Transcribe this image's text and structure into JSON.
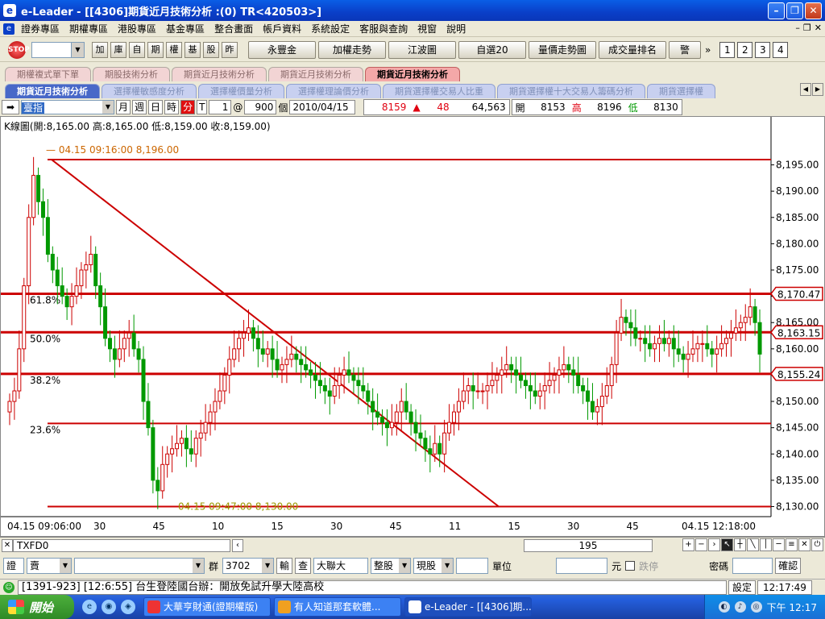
{
  "window": {
    "title": "e-Leader - [[4306]期貨近月技術分析 :(0) TR<420503>]"
  },
  "menu": [
    "證券專區",
    "期權專區",
    "港股專區",
    "基金專區",
    "整合畫面",
    "帳戶資料",
    "系統設定",
    "客服與查詢",
    "視窗",
    "說明"
  ],
  "toolbar": {
    "square_buttons": [
      "加",
      "庫",
      "自",
      "期",
      "權",
      "基",
      "股",
      "昨"
    ],
    "buttons": [
      "永豐金",
      "加權走勢",
      "江波圖",
      "自選20",
      "量價走勢圖",
      "成交量排名",
      "警"
    ],
    "numbers": [
      "1",
      "2",
      "3",
      "4"
    ]
  },
  "tabs1": [
    "期權複式單下單",
    "期股技術分析",
    "期貨近月技術分析",
    "期貨近月技術分析",
    "期貨近月技術分析"
  ],
  "tabs1_active": 4,
  "tabs2": [
    "期貨近月技術分析",
    "選擇權敏感度分析",
    "選擇權價量分析",
    "選擇權理論價分析",
    "期貨選擇權交易人比重",
    "期貨選擇權十大交易人籌碼分析",
    "期貨選擇權"
  ],
  "tabs2_active": 0,
  "quote": {
    "symbol": "臺指",
    "periods": [
      "月",
      "週",
      "日",
      "時",
      "分",
      "T"
    ],
    "active_period": "分",
    "interval": "1",
    "at": "@",
    "count": "900",
    "count_unit": "個",
    "date": "2010/04/15",
    "price": "8159",
    "change_arrow": "▲",
    "change": "48",
    "volume": "64,563",
    "open_label": "開",
    "open": "8153",
    "high_label": "高",
    "high": "8196",
    "low_label": "低",
    "low": "8130"
  },
  "chart_info": "K線圖(開:8,165.00 高:8,165.00 低:8,159.00 收:8,159.00)",
  "chart_data": {
    "type": "candlestick",
    "y_ticks": [
      "8,195.00",
      "8,190.00",
      "8,185.00",
      "8,180.00",
      "8,175.00",
      "8,170.00",
      "8,165.00",
      "8,160.00",
      "8,155.00",
      "8,150.00",
      "8,145.00",
      "8,140.00",
      "8,135.00",
      "8,130.00"
    ],
    "ylim": [
      8129,
      8198
    ],
    "x_ticks": [
      "04.15 09:06:00",
      "30",
      "45",
      "10",
      "15",
      "30",
      "45",
      "11",
      "15",
      "30",
      "45",
      "04.15 12:18:00"
    ],
    "high_annotation": "04.15 09:16:00  8,196.00",
    "low_annotation": "04.15 09:47:00  8,130.00",
    "fib_levels": [
      {
        "label": "61.8%",
        "value": 8170.47,
        "tag": "8,170.47"
      },
      {
        "label": "50.0%",
        "value": 8163.15,
        "tag": "8,163.15"
      },
      {
        "label": "38.2%",
        "value": 8155.24,
        "tag": "8,155.24"
      },
      {
        "label": "23.6%",
        "value": 8145.8,
        "tag": ""
      }
    ],
    "top_line": 8196,
    "bottom_line": 8130,
    "trend_line": {
      "from_x": 0.06,
      "from_y": 8196,
      "to_x": 0.645,
      "to_y": 8130
    },
    "close_series": [
      8150,
      8152,
      8160,
      8172,
      8185,
      8193,
      8188,
      8185,
      8178,
      8175,
      8172,
      8170,
      8168,
      8170,
      8172,
      8175,
      8176,
      8178,
      8172,
      8168,
      8162,
      8160,
      8158,
      8160,
      8162,
      8163,
      8160,
      8158,
      8150,
      8145,
      8135,
      8133,
      8138,
      8140,
      8141,
      8142,
      8143,
      8141,
      8140,
      8143,
      8144,
      8146,
      8148,
      8150,
      8152,
      8155,
      8158,
      8160,
      8162,
      8163,
      8164,
      8162,
      8160,
      8159,
      8160,
      8158,
      8156,
      8157,
      8158,
      8159,
      8158,
      8157,
      8156,
      8155,
      8154,
      8153,
      8152,
      8151,
      8153,
      8155,
      8156,
      8155,
      8154,
      8153,
      8152,
      8150,
      8148,
      8147,
      8146,
      8145,
      8146,
      8148,
      8150,
      8148,
      8146,
      8144,
      8143,
      8141,
      8140,
      8142,
      8140,
      8144,
      8146,
      8148,
      8150,
      8152,
      8153,
      8152,
      8152,
      8152,
      8153,
      8154,
      8155,
      8156,
      8157,
      8156,
      8155,
      8154,
      8153,
      8152,
      8151,
      8152,
      8153,
      8154,
      8155,
      8156,
      8157,
      8156,
      8155,
      8153,
      8152,
      8150,
      8148,
      8149,
      8151,
      8153,
      8157,
      8163,
      8166,
      8165,
      8164,
      8162,
      8162,
      8161,
      8160,
      8161,
      8162,
      8161,
      8162,
      8160,
      8159,
      8158,
      8159,
      8160,
      8161,
      8161,
      8160,
      8159,
      8160,
      8161,
      8162,
      8163,
      8164,
      8165,
      8166,
      8168,
      8165,
      8159
    ]
  },
  "scroll": {
    "symbol": "TXFD0",
    "position": "195"
  },
  "order": {
    "market": "證",
    "side": "賣",
    "group_label": "群",
    "group": "3702",
    "broker_label": "輸",
    "query_label": "查",
    "broker": "大聯大",
    "lot": "整股",
    "type": "現股",
    "unit_label": "單位",
    "yuan_label": "元",
    "stop_label": "跌停",
    "pwd_label": "密碼",
    "confirm": "確認"
  },
  "news": {
    "text": "[1391-923] [12:6:55] 台生登陸國台辦：開放免試升學大陸高校",
    "settings": "設定",
    "time": "12:17:49"
  },
  "taskbar": {
    "start": "開始",
    "tasks": [
      "大華亨財通(證期權版)",
      "有人知道那套軟體...",
      "e-Leader - [[4306]期..."
    ],
    "clock": "下午 12:17"
  }
}
